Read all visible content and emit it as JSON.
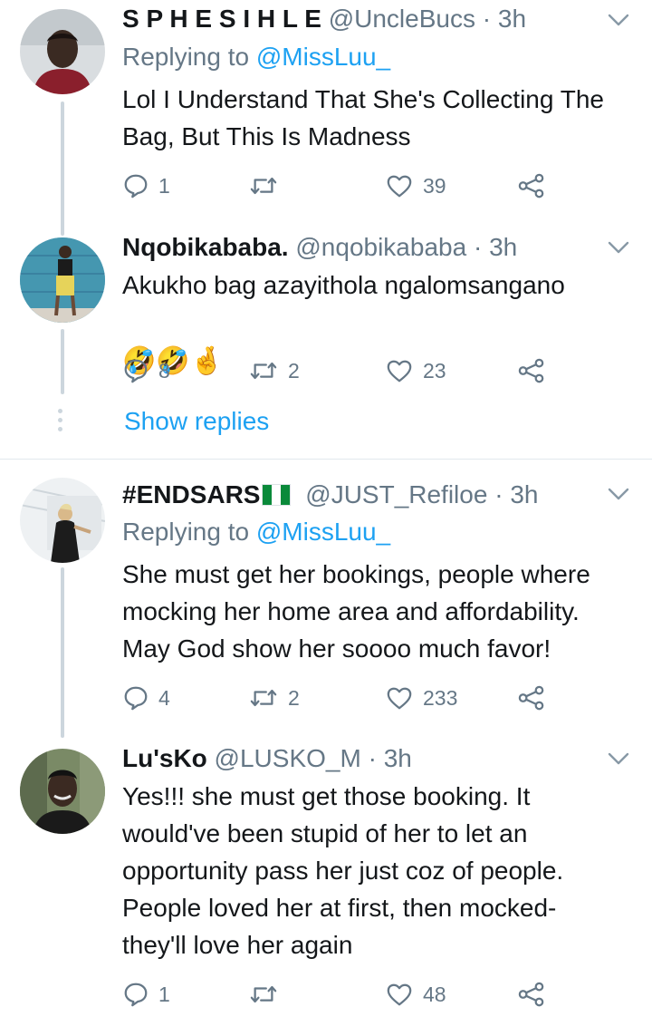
{
  "tweets": [
    {
      "name": "S P H E S I H L E",
      "handle": "@UncleBucs",
      "dot": "·",
      "time": "3h",
      "replying_prefix": "Replying to ",
      "replying_to": "@MissLuu_",
      "text": "Lol I Understand That She's Collecting The Bag, But This Is Madness",
      "reply_count": "1",
      "retweet_count": "",
      "like_count": "39"
    },
    {
      "name": "Nqobikababa.",
      "handle": "@nqobikababa",
      "dot": "·",
      "time": "3h",
      "text": "Akukho bag azayithola ngalomsangano",
      "emojis": "🤣🤣🤞",
      "reply_count": "8",
      "retweet_count": "2",
      "like_count": "23"
    },
    {
      "name": "#ENDSARS",
      "flag": "nigeria-flag",
      "handle": "@JUST_Refiloe",
      "dot": "·",
      "time": "3h",
      "replying_prefix": "Replying to ",
      "replying_to": "@MissLuu_",
      "text": "She must get her bookings, people where mocking her home area and affordability. May God show her soooo much favor!",
      "reply_count": "4",
      "retweet_count": "2",
      "like_count": "233"
    },
    {
      "name": "Lu'sKo",
      "handle": "@LUSKO_M",
      "dot": "·",
      "time": "3h",
      "text": "Yes!!! she must get those booking. It would've been stupid of her to let an opportunity pass her just coz of people. People loved her at first, then mocked- they'll love her again",
      "reply_count": "1",
      "retweet_count": "",
      "like_count": "48"
    }
  ],
  "show_replies": "Show replies",
  "colors": {
    "text": "#14171a",
    "secondary": "#657786",
    "accent": "#1da1f2",
    "thread_line": "#ccd6dd",
    "divider": "#e1e8ed"
  },
  "icons": [
    "reply-icon",
    "retweet-icon",
    "like-icon",
    "share-icon",
    "chevron-down-icon"
  ]
}
